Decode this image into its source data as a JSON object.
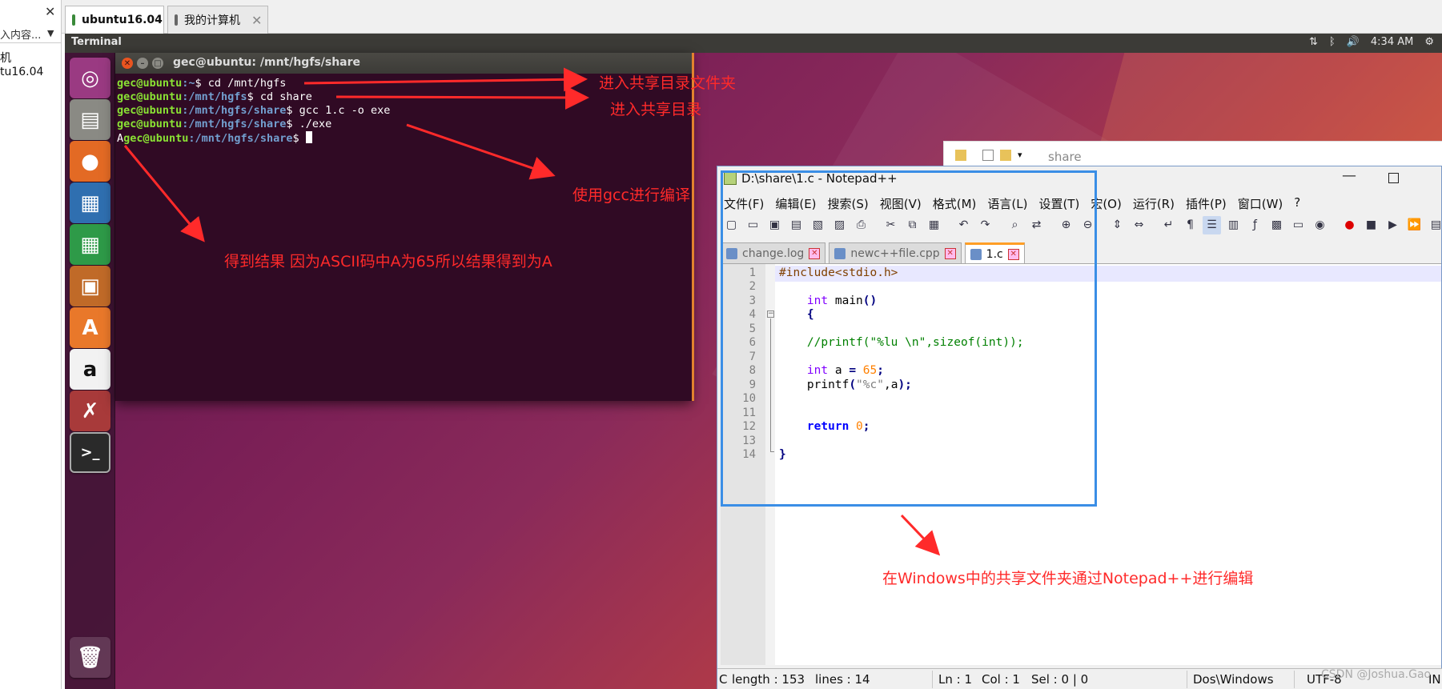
{
  "left_panel": {
    "search_text": "入内容...",
    "tree": [
      "机",
      "tu16.04"
    ]
  },
  "vm_tabs": [
    {
      "label": "ubuntu16.04"
    },
    {
      "label": "我的计算机"
    }
  ],
  "ubuntu": {
    "topbar_title": "Terminal",
    "time": "4:34 AM"
  },
  "terminal": {
    "title": "gec@ubuntu: /mnt/hgfs/share",
    "lines": [
      {
        "prefix": "",
        "user": "gec@ubuntu",
        "path": ":~",
        "cmd": "$ cd /mnt/hgfs"
      },
      {
        "prefix": "",
        "user": "gec@ubuntu",
        "path": ":/mnt/hgfs",
        "cmd": "$ cd share"
      },
      {
        "prefix": "",
        "user": "gec@ubuntu",
        "path": ":/mnt/hgfs/share",
        "cmd": "$ gcc 1.c -o exe"
      },
      {
        "prefix": "",
        "user": "gec@ubuntu",
        "path": ":/mnt/hgfs/share",
        "cmd": "$ ./exe"
      },
      {
        "prefix": "A",
        "user": "gec@ubuntu",
        "path": ":/mnt/hgfs/share",
        "cmd": "$ "
      }
    ]
  },
  "explorer": {
    "path": "share"
  },
  "notepad": {
    "title": "D:\\share\\1.c - Notepad++",
    "menu": [
      "文件(F)",
      "编辑(E)",
      "搜索(S)",
      "视图(V)",
      "格式(M)",
      "语言(L)",
      "设置(T)",
      "宏(O)",
      "运行(R)",
      "插件(P)",
      "窗口(W)",
      "?"
    ],
    "tabs": [
      {
        "label": "change.log"
      },
      {
        "label": "newc++file.cpp"
      },
      {
        "label": "1.c"
      }
    ],
    "line_numbers": [
      "1",
      "2",
      "3",
      "4",
      "5",
      "6",
      "7",
      "8",
      "9",
      "10",
      "11",
      "12",
      "13",
      "14"
    ],
    "code": {
      "l1": "#include<stdio.h>",
      "l3_kw": "int",
      "l3_rest": " main",
      "l3_paren": "()",
      "l4": "{",
      "l6": "//printf(\"%lu \\n\",sizeof(int));",
      "l8_kw": "int",
      "l8_mid": " a ",
      "l8_eq": "=",
      "l8_num": " 65",
      "l8_semi": ";",
      "l9_fn": "printf",
      "l9_open": "(",
      "l9_str": "\"%c\"",
      "l9_rest": ",a",
      "l9_close": ");",
      "l12_kw": "return",
      "l12_num": " 0",
      "l12_semi": ";",
      "l14": "}"
    },
    "status": {
      "type": "C",
      "length": "length : 153",
      "lines": "lines : 14",
      "ln": "Ln : 1",
      "col": "Col : 1",
      "sel": "Sel : 0 | 0",
      "eol": "Dos\\Windows",
      "enc": "UTF-8",
      "ins": "IN"
    }
  },
  "annotations": {
    "a1": "进入共享目录文件夹",
    "a2": "进入共享目录",
    "a3": "使用gcc进行编译",
    "a4": "得到结果 因为ASCII码中A为65所以结果得到为A",
    "a5": "在Windows中的共享文件夹通过Notepad++进行编辑"
  },
  "watermark": "CSDN @Joshua.Gao",
  "colors": {
    "terminal_bg": "#300a24",
    "annotation": "#ff2a2a",
    "highlight_box": "#3a8ee6"
  }
}
